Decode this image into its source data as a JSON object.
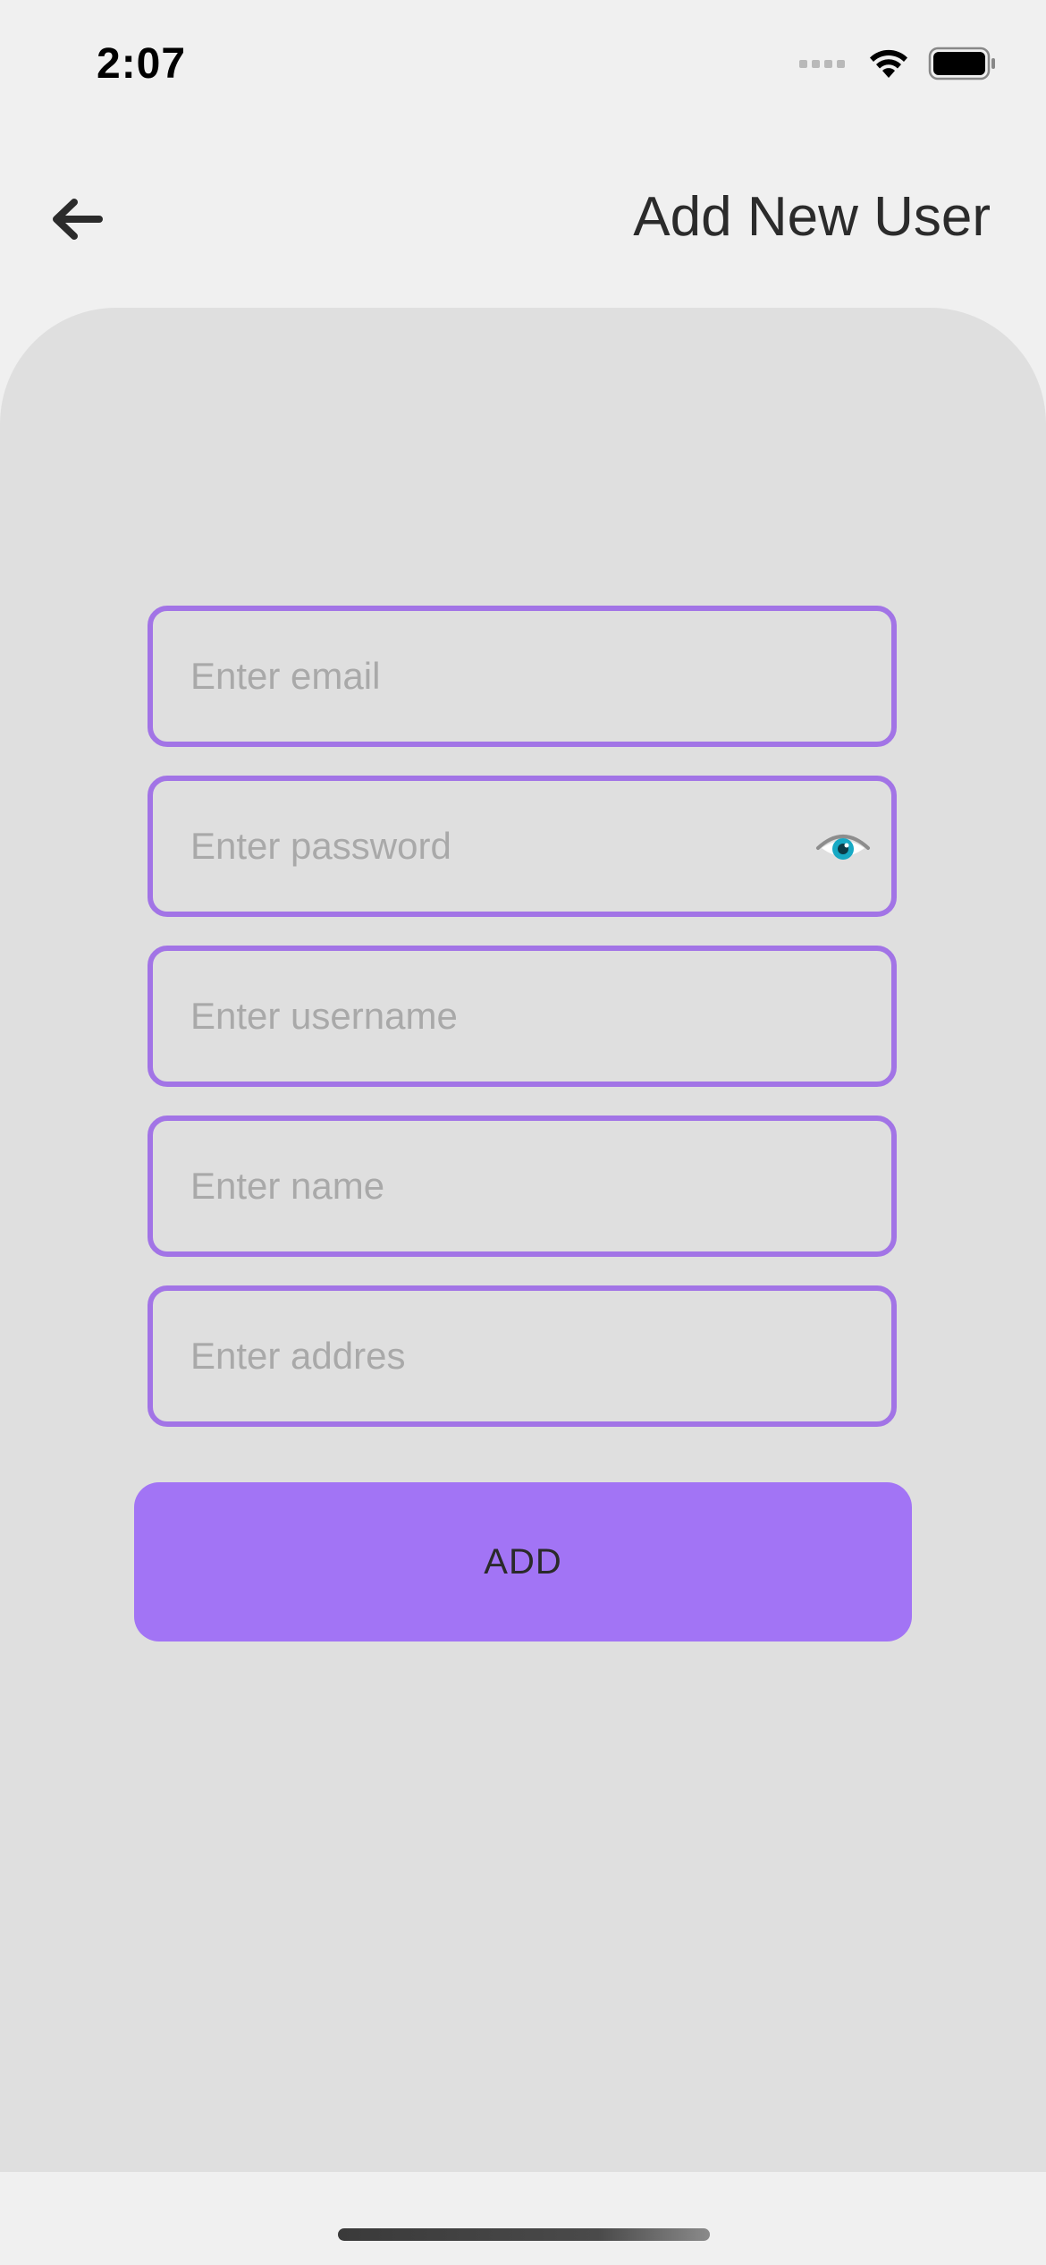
{
  "status_bar": {
    "time": "2:07"
  },
  "header": {
    "title": "Add New User",
    "back_icon": "arrow-left-icon"
  },
  "form": {
    "email_placeholder": "Enter email",
    "password_placeholder": "Enter password",
    "username_placeholder": "Enter username",
    "name_placeholder": "Enter name",
    "address_placeholder": "Enter addres",
    "password_toggle_icon": "eye-icon",
    "add_label": "ADD"
  },
  "colors": {
    "accent": "#a274f5",
    "field_border": "#a274e6",
    "panel": "#dfdfdf",
    "background": "#f0f0f0"
  }
}
